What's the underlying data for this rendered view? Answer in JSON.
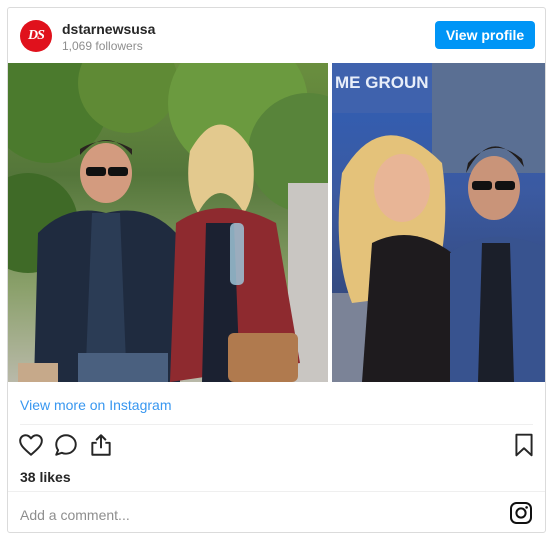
{
  "profile": {
    "avatar_text": "DS",
    "username": "dstarnewsusa",
    "followers": "1,069 followers",
    "view_profile_label": "View profile"
  },
  "media": {
    "left_sign_text": "",
    "right_sign_text": "ME GROUN"
  },
  "view_more_label": "View more on Instagram",
  "likes": "38 likes",
  "comment_placeholder": "Add a comment...",
  "icons": {
    "like": "heart-icon",
    "comment": "comment-icon",
    "share": "share-icon",
    "save": "bookmark-icon",
    "instagram": "instagram-icon"
  },
  "colors": {
    "accent": "#0095f6",
    "link": "#3897f0",
    "avatar": "#e0111c",
    "text": "#262626",
    "muted": "#8e8e8e"
  }
}
